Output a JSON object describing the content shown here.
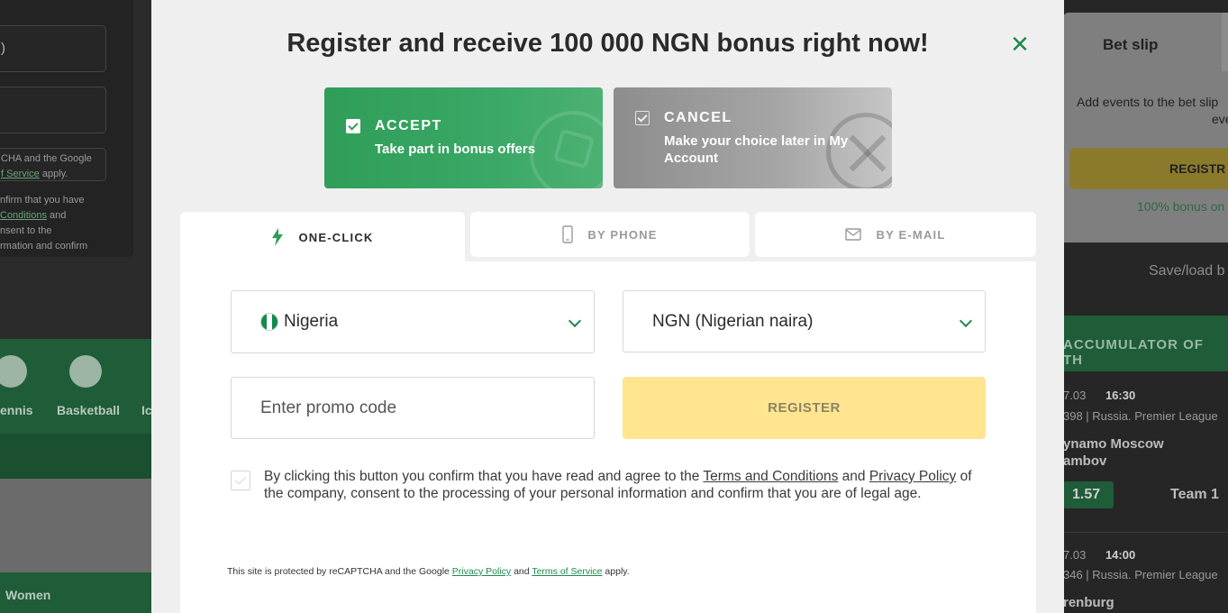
{
  "background": {
    "left": {
      "partial_recaptcha_text": "CHA and the Google",
      "partial_terms_link": "f Service",
      "partial_apply": "apply.",
      "partial_confirm_lines": [
        "nfirm that you have",
        "Conditions",
        "and",
        "nsent to the",
        "rmation and confirm"
      ],
      "sports": [
        {
          "label": "ennis"
        },
        {
          "label": "Basketball"
        },
        {
          "label": "Ic"
        }
      ],
      "women_label": "Women",
      "partial_field_text": ")"
    },
    "right": {
      "bet_slip_title": "Bet slip",
      "bet_slip_text": "Add events to the bet slip",
      "bet_slip_text2": "even",
      "register_label": "REGISTR",
      "bonus_text": "100% bonus on",
      "save_load": "Save/load b",
      "accumulator": "ACCUMULATOR OF TH",
      "events": [
        {
          "date": "7.03",
          "time": "16:30",
          "league": "398 | Russia. Premier League",
          "team_a": "ynamo Moscow",
          "team_b": "ambov",
          "odd": "1.57",
          "team1": "Team 1"
        },
        {
          "date": "7.03",
          "time": "14:00",
          "league": "346 | Russia. Premier League",
          "team_a": "renburg"
        }
      ]
    }
  },
  "modal": {
    "title": "Register and receive 100 000 NGN bonus right now!",
    "close_icon": "close-icon",
    "accept": {
      "heading": "ACCEPT",
      "subtext": "Take part in bonus offers"
    },
    "cancel": {
      "heading": "CANCEL",
      "subtext": "Make your choice later in My Account"
    },
    "tabs": [
      {
        "label": "ONE-CLICK",
        "icon": "lightning-icon",
        "active": true
      },
      {
        "label": "BY PHONE",
        "icon": "phone-icon",
        "active": false
      },
      {
        "label": "BY E-MAIL",
        "icon": "envelope-icon",
        "active": false
      }
    ],
    "form": {
      "country": "Nigeria",
      "currency": "NGN (Nigerian naira)",
      "promo_placeholder": "Enter promo code",
      "register_label": "REGISTER",
      "agreement": {
        "part1": "By clicking this button you confirm that you have read and agree to the ",
        "terms_link": "Terms and Conditions",
        "part2": " and ",
        "privacy_link": "Privacy Policy",
        "part3": " of the company, consent to the processing of your personal information and confirm that you are of legal age."
      },
      "recaptcha": {
        "part1": "This site is protected by reCAPTCHA and the Google ",
        "privacy_link": "Privacy Policy",
        "part2": " and ",
        "terms_link": "Terms of Service",
        "part3": " apply."
      }
    },
    "colors": {
      "brand_green": "#1f8a4c",
      "accept_green": "#2f9e58",
      "register_yellow": "#ffe58f"
    }
  }
}
